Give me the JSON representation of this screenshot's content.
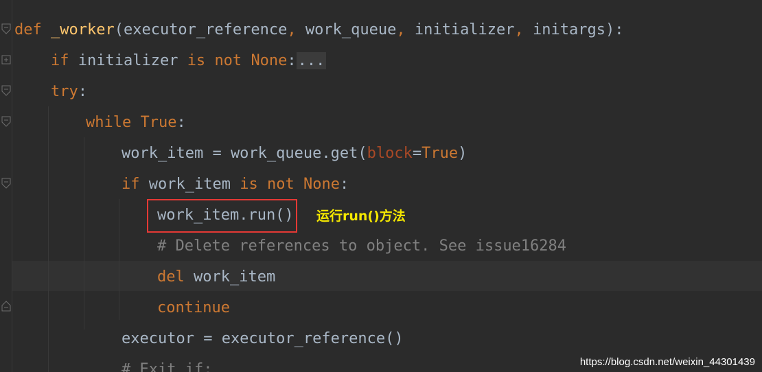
{
  "editor": {
    "lines": [
      {
        "t1": "def",
        "t2": " ",
        "t3": "_worker",
        "t4": "(executor_reference",
        "t5": ",",
        "t6": " work_queue",
        "t7": ",",
        "t8": " initializer",
        "t9": ",",
        "t10": " initargs):"
      },
      {
        "t1": "if",
        "t2": " initializer ",
        "t3": "is",
        "t4": " ",
        "t5": "not",
        "t6": " ",
        "t7": "None",
        "t8": ":",
        "t9": "..."
      },
      {
        "t1": "try",
        "t2": ":"
      },
      {
        "t1": "while",
        "t2": " ",
        "t3": "True",
        "t4": ":"
      },
      {
        "t1": "work_item = work_queue.get(",
        "t2": "block",
        "t3": "=",
        "t4": "True",
        "t5": ")"
      },
      {
        "t1": "if",
        "t2": " work_item ",
        "t3": "is",
        "t4": " ",
        "t5": "not",
        "t6": " ",
        "t7": "None",
        "t8": ":"
      },
      {
        "t1": "work_item.run()"
      },
      {
        "t1": "# Delete references to object. See issue16284"
      },
      {
        "t1": "del",
        "t2": " work_item"
      },
      {
        "t1": "continue"
      },
      {
        "t1": "executor = executor_reference()"
      },
      {
        "t1": "# Exit if:"
      }
    ]
  },
  "annotation": {
    "text": "运行run()方法"
  },
  "watermark": {
    "text": "https://blog.csdn.net/weixin_44301439"
  },
  "colors": {
    "background": "#2b2b2b",
    "keyword": "#cc7832",
    "function_name": "#ffc66d",
    "text": "#a9b7c6",
    "parameter": "#aa4926",
    "comment": "#808080",
    "highlight_border": "#e53935",
    "annotation": "#f5e800"
  },
  "icons": [
    "fold-open-icon",
    "fold-closed-icon",
    "fold-end-icon"
  ]
}
